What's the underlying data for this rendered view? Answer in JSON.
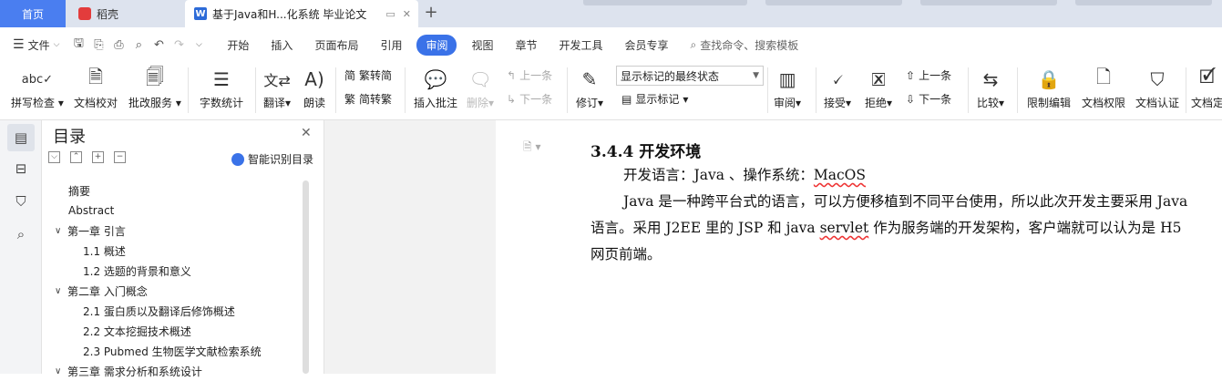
{
  "tabs": {
    "home": "首页",
    "daoke": "稻壳",
    "document": "基于Java和H...化系统 毕业论文"
  },
  "menu": {
    "file": "文件",
    "items": [
      "开始",
      "插入",
      "页面布局",
      "引用",
      "审阅",
      "视图",
      "章节",
      "开发工具",
      "会员专享"
    ],
    "active": "审阅",
    "search": "查找命令、搜索模板"
  },
  "ribbon": {
    "spellcheck": "拼写检查",
    "proofread": "文档校对",
    "correction_service": "批改服务",
    "word_count": "字数统计",
    "translate": "翻译",
    "read_aloud": "朗读",
    "trad_to_simp": "繁转简",
    "simp_to_trad": "简转繁",
    "insert_comment": "插入批注",
    "delete": "删除",
    "prev_comment": "上一条",
    "next_comment": "下一条",
    "track_changes": "修订",
    "markup_mode": "显示标记的最终状态",
    "show_markup": "显示标记",
    "review": "审阅",
    "accept": "接受",
    "reject": "拒绝",
    "prev_change": "上一条",
    "next_change": "下一条",
    "compare": "比较",
    "restrict_editing": "限制编辑",
    "doc_permissions": "文档权限",
    "doc_certify": "文档认证",
    "doc_final": "文档定"
  },
  "toc": {
    "title": "目录",
    "smart": "智能识别目录",
    "items": [
      {
        "label": "摘要",
        "level": 0
      },
      {
        "label": "Abstract",
        "level": 0
      },
      {
        "label": "第一章  引言",
        "level": 1
      },
      {
        "label": "1.1  概述",
        "level": 2
      },
      {
        "label": "1.2  选题的背景和意义",
        "level": 2
      },
      {
        "label": "第二章  入门概念",
        "level": 1
      },
      {
        "label": "2.1  蛋白质以及翻译后修饰概述",
        "level": 2
      },
      {
        "label": "2.2 文本挖掘技术概述",
        "level": 2
      },
      {
        "label": "2.3 Pubmed 生物医学文献检索系统",
        "level": 2
      },
      {
        "label": "第三章  需求分析和系统设计",
        "level": 1
      }
    ]
  },
  "document": {
    "heading": "3.4.4  开发环境",
    "line1_prefix": "开发语言：Java 、操作系统：",
    "line1_os": "MacOS",
    "para_a": "Java 是一种跨平台式的语言，可以方便移植到不同平台使用，所以此次开发主要采用 Java 语言。采用 J2EE 里的 JSP 和 java ",
    "para_servlet": "servlet",
    "para_b": " 作为服务端的开发架构，客户端就可以认为是 H5 网页前端。"
  }
}
